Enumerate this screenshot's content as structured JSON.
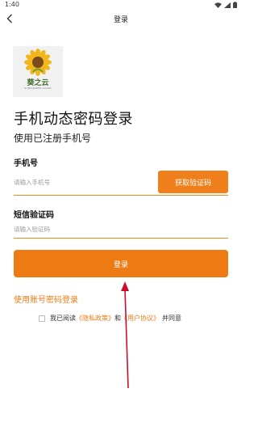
{
  "status": {
    "time": "1:40"
  },
  "nav": {
    "title": "登录"
  },
  "logo": {
    "text": "葵之云",
    "sub": "SUNFLOWER CLOUD"
  },
  "heading": {
    "title": "手机动态密码登录",
    "subtitle": "使用已注册手机号"
  },
  "phone": {
    "label": "手机号",
    "placeholder": "请输入手机号",
    "button": "获取验证码"
  },
  "sms": {
    "label": "短信验证码",
    "placeholder": "请输入验证码"
  },
  "login_button": "登录",
  "account_login_link": "使用账号密码登录",
  "agreement": {
    "prefix": "我已阅读",
    "privacy": "《隐私政策》",
    "and": "和",
    "user": "《用户协议》",
    "suffix": "并同意"
  },
  "colors": {
    "accent": "#ee7a14",
    "annotation_arrow": "#c8102e"
  },
  "icons": [
    "back-arrow-icon",
    "wifi-icon",
    "signal-icon",
    "battery-icon",
    "sunflower-logo-icon"
  ]
}
